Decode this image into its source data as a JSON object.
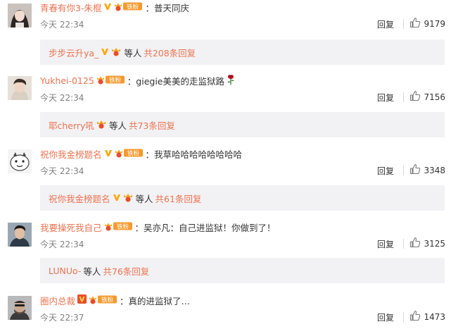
{
  "colors": {
    "link": "#eb7350",
    "text": "#333333",
    "muted": "#808080",
    "reply_bg": "#f2f2f5",
    "vip_gold": "#ffa600",
    "vip_red": "#e94d2a",
    "fan_orange": "#f59a2e"
  },
  "comments": [
    {
      "username": "青春有你3-朱棍",
      "vip_badge": "gold",
      "fan_label": "铁粉",
      "separator": "：",
      "text": "普天同庆",
      "time": "今天 22:34",
      "reply_label": "回复",
      "likes": "9179",
      "reply_bar": {
        "name": "步步云升ya_",
        "vip_badge": "gold",
        "suffix": "等人",
        "count_text": "共208条回复"
      }
    },
    {
      "username": "Yukhei-0125",
      "vip_badge": "none",
      "fan_label": "铁粉",
      "separator": "：",
      "text": "giegie美美的走监狱路",
      "emoji": "rose-emoji",
      "time": "今天 22:34",
      "reply_label": "回复",
      "likes": "7156",
      "reply_bar": {
        "name": "耶cherry吼",
        "vip_badge": "none",
        "suffix": "等人",
        "count_text": "共73条回复"
      }
    },
    {
      "username": "祝你我金榜题名",
      "vip_badge": "gold",
      "fan_label": "铁粉",
      "separator": "：",
      "text": "我草哈哈哈哈哈哈哈哈",
      "time": "今天 22:34",
      "reply_label": "回复",
      "likes": "3348",
      "reply_bar": {
        "name": "祝你我金榜题名",
        "vip_badge": "gold",
        "suffix": "等人",
        "count_text": "共61条回复"
      }
    },
    {
      "username": "我要操死我自己",
      "vip_badge": "none",
      "fan_label": "铁粉",
      "separator": "：",
      "text": "吴亦凡：自己进监狱！你做到了！",
      "time": "今天 22:34",
      "reply_label": "回复",
      "likes": "3125",
      "reply_bar": {
        "name": "LUNUo-",
        "vip_badge": "none",
        "suffix": "等人",
        "count_text": "共76条回复"
      }
    },
    {
      "username": "圈内总裁",
      "vip_badge": "red",
      "fan_label": "铁粉",
      "separator": "：",
      "text": "真的进监狱了…",
      "time": "今天 22:37",
      "reply_label": "回复",
      "likes": "1473"
    }
  ]
}
